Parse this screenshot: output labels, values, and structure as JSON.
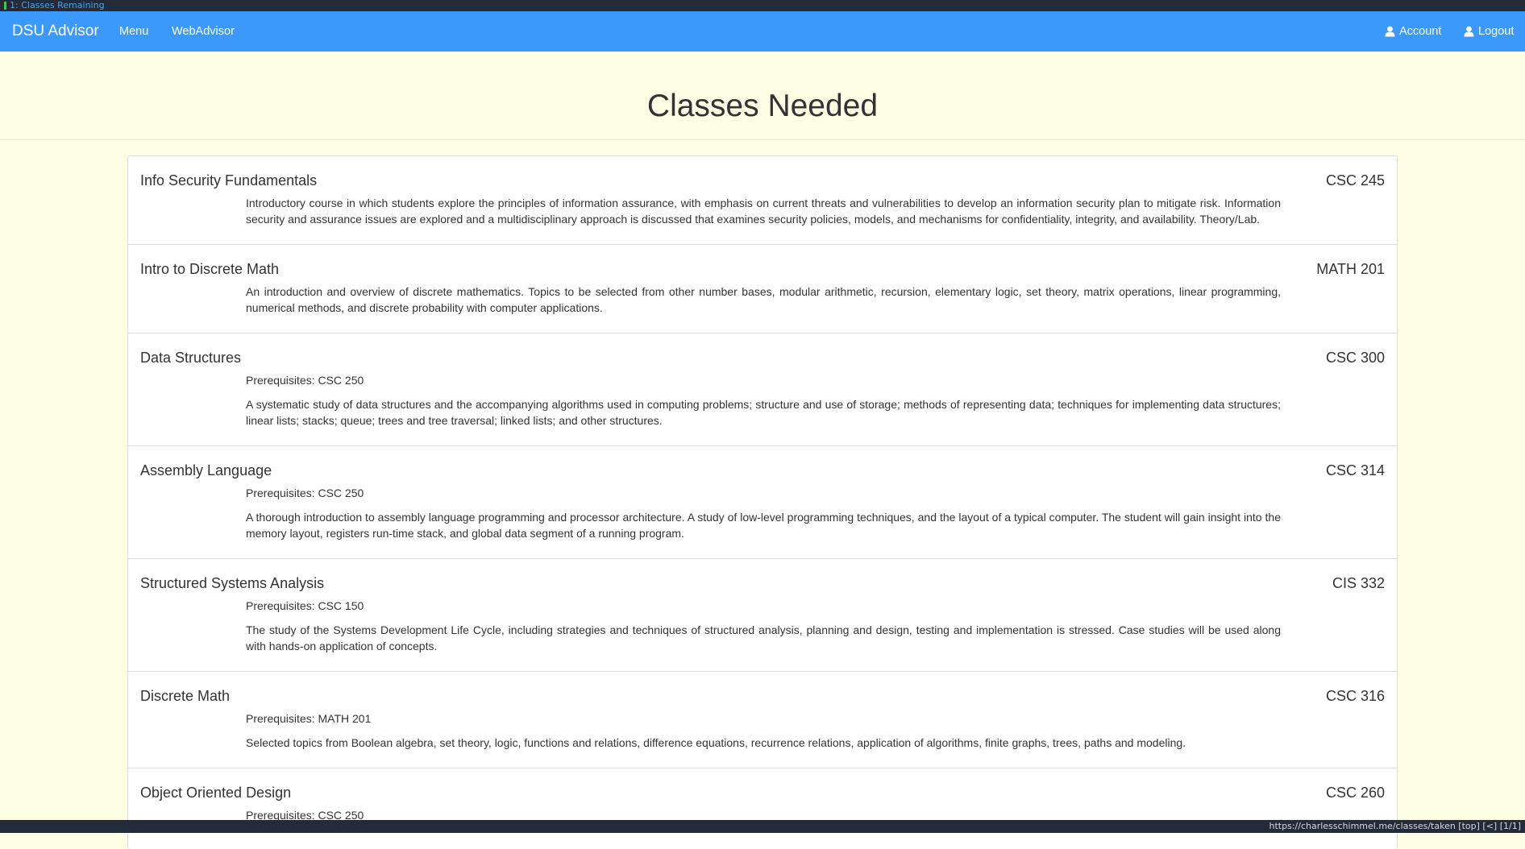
{
  "tabbar": {
    "title": "1: Classes Remaining"
  },
  "navbar": {
    "brand": "DSU Advisor",
    "menu": "Menu",
    "webadvisor": "WebAdvisor",
    "account": "Account",
    "logout": "Logout"
  },
  "page": {
    "title": "Classes Needed"
  },
  "courses": [
    {
      "name": "Info Security Fundamentals",
      "code": "CSC 245",
      "prereq": "",
      "description": "Introductory course in which students explore the principles of information assurance, with emphasis on current threats and vulnerabilities to develop an information security plan to mitigate risk. Information security and assurance issues are explored and a multidisciplinary approach is discussed that examines security policies, models, and mechanisms for confidentiality, integrity, and availability. Theory/Lab."
    },
    {
      "name": "Intro to Discrete Math",
      "code": "MATH 201",
      "prereq": "",
      "description": "An introduction and overview of discrete mathematics. Topics to be selected from other number bases, modular arithmetic, recursion, elementary logic, set theory, matrix operations, linear programming, numerical methods, and discrete probability with computer applications."
    },
    {
      "name": "Data Structures",
      "code": "CSC 300",
      "prereq": "Prerequisites: CSC 250",
      "description": "A systematic study of data structures and the accompanying algorithms used in computing problems; structure and use of storage; methods of representing data; techniques for implementing data structures; linear lists; stacks; queue; trees and tree traversal; linked lists; and other structures."
    },
    {
      "name": "Assembly Language",
      "code": "CSC 314",
      "prereq": "Prerequisites: CSC 250",
      "description": "A thorough introduction to assembly language programming and processor architecture. A study of low-level programming techniques, and the layout of a typical computer. The student will gain insight into the memory layout, registers run-time stack, and global data segment of a running program."
    },
    {
      "name": "Structured Systems Analysis",
      "code": "CIS 332",
      "prereq": "Prerequisites: CSC 150",
      "description": "The study of the Systems Development Life Cycle, including strategies and techniques of structured analysis, planning and design, testing and implementation is stressed. Case studies will be used along with hands-on application of concepts."
    },
    {
      "name": "Discrete Math",
      "code": "CSC 316",
      "prereq": "Prerequisites: MATH 201",
      "description": "Selected topics from Boolean algebra, set theory, logic, functions and relations, difference equations, recurrence relations, application of algorithms, finite graphs, trees, paths and modeling."
    },
    {
      "name": "Object Oriented Design",
      "code": "CSC 260",
      "prereq": "Prerequisites: CSC 250",
      "description": ""
    }
  ],
  "statusbar": {
    "url": "https://charlesschimmel.me/classes/taken [top] [<] [1/1]"
  }
}
